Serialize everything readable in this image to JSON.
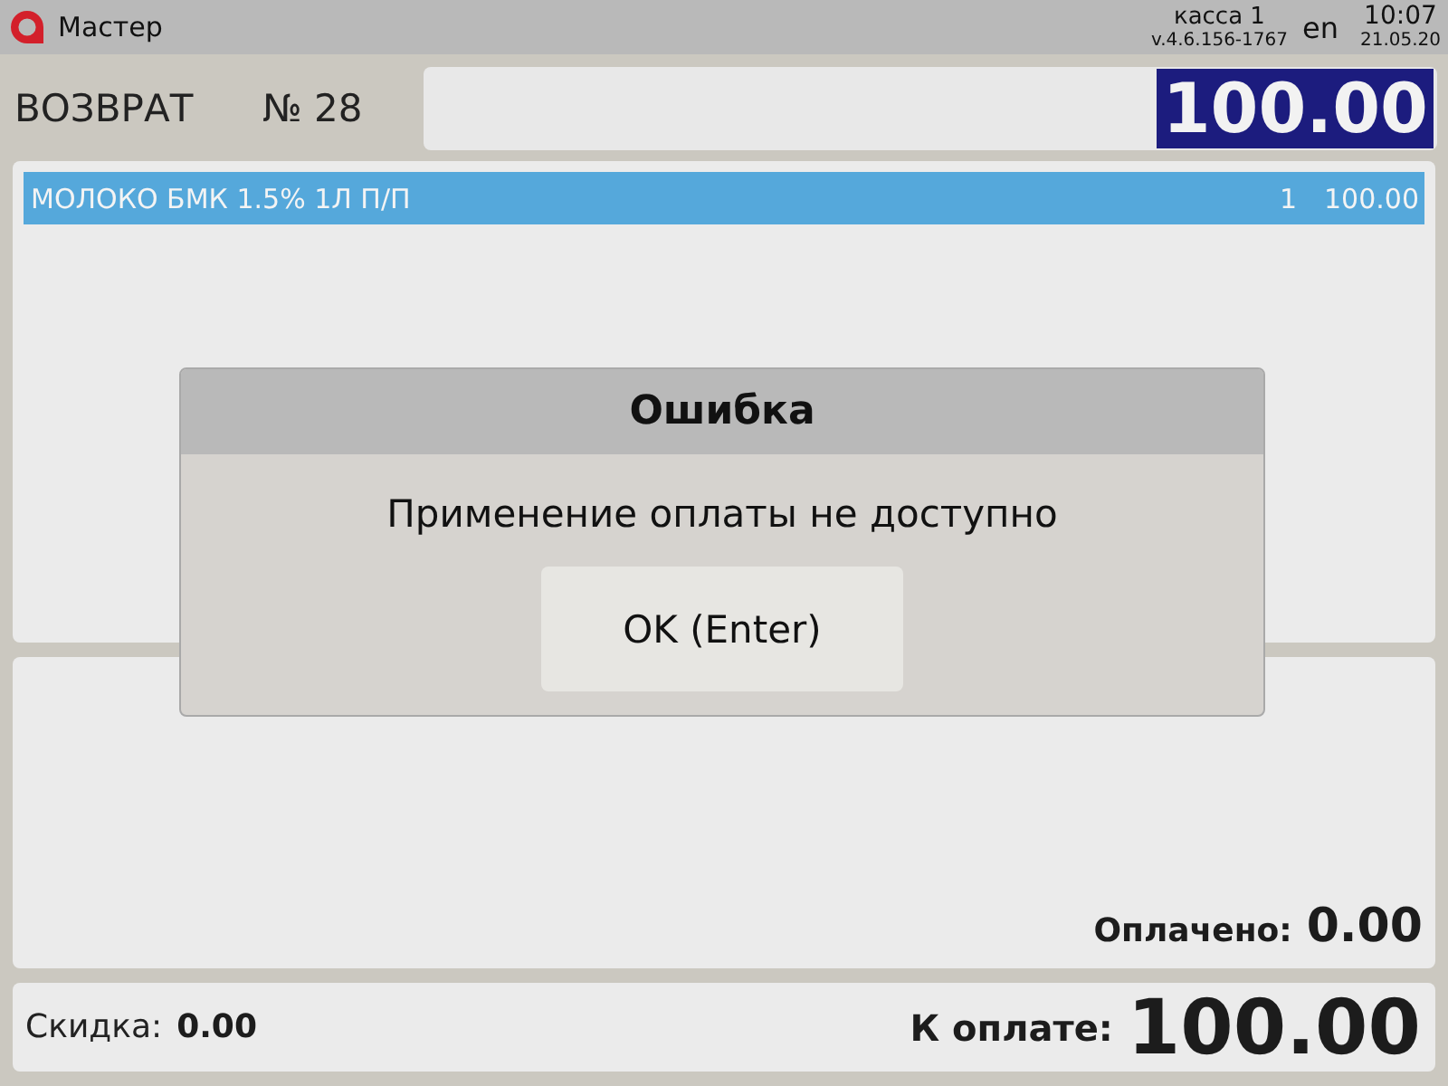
{
  "top_bar": {
    "title": "Мастер",
    "register": "касса 1",
    "version": "v.4.6.156-1767",
    "language": "en",
    "time": "10:07",
    "date": "21.05.20"
  },
  "receipt": {
    "mode": "ВОЗВРАТ",
    "number": "№ 28",
    "input_value": "100.00",
    "value_selected": true
  },
  "items": [
    {
      "name": "МОЛОКО БМК 1.5% 1Л П/П",
      "quantity": "1",
      "sum": "100.00",
      "selected": true
    }
  ],
  "payments": {
    "paid_label": "Оплачено:",
    "paid_value": "0.00"
  },
  "totals": {
    "discount_label": "Скидка:",
    "discount_value": "0.00",
    "due_label": "К оплате:",
    "due_value": "100.00"
  },
  "dialog": {
    "title": "Ошибка",
    "message": "Применение оплаты не доступно",
    "button": "OK (Enter)"
  }
}
